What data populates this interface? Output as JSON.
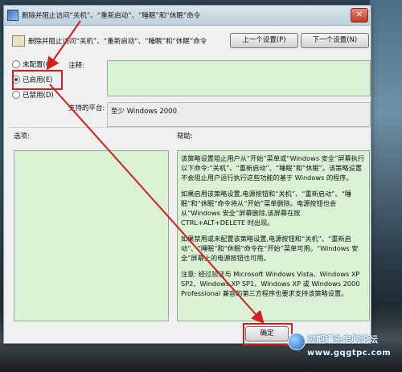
{
  "window": {
    "title": "删除并阻止访问“关机”、“重新启动”、“睡眠”和“休眠”命令",
    "close_symbol": "✕"
  },
  "header": {
    "policy_title": "删除并阻止访问“关机”、“重新启动”、“睡眠”和“休眠”命令",
    "prev_button": "上一个设置(P)",
    "next_button": "下一个设置(N)"
  },
  "state": {
    "options": [
      {
        "label": "未配置(C)",
        "checked": false
      },
      {
        "label": "已启用(E)",
        "checked": true
      },
      {
        "label": "已禁用(D)",
        "checked": false
      }
    ]
  },
  "labels": {
    "comment": "注释:",
    "supported_on": "支持的平台:",
    "options": "选项:",
    "help": "帮助:"
  },
  "supported_platform": "至少 Windows 2000",
  "help_paragraphs": [
    "该策略设置阻止用户从“开始”菜单或“Windows 安全”屏幕执行以下命令:“关机”、“重新启动”、“睡眠”和“休眠”。该策略设置不会阻止用户运行执行这些功能的基于 Windows 的程序。",
    "如果启用该策略设置,电源按钮和“关机”、“重新启动”、“睡眠”和“休眠”命令将从“开始”菜单删除。电源按钮也会从“Windows 安全”屏幕删除,该屏幕在按 CTRL+ALT+DELETE 时出现。",
    "如果禁用或未配置该策略设置,电源按钮和“关机”、“重新启动”、“睡眠”和“休眠”命令在“开始”菜单可用。“Windows 安全”屏幕上的电源按钮也可用。",
    "注意: 经过验证与 Microsoft Windows Vista、Windows XP SP2、Windows XP SP1、Windows XP 或 Windows 2000 Professional 兼容的第三方程序也要求支持该策略设置。"
  ],
  "buttons": {
    "ok": "确定"
  },
  "watermark": {
    "name": "过期罐头电脑论坛",
    "url": "www.gqgtpc.com"
  },
  "colors": {
    "highlight": "#d41e1e",
    "field_bg": "#d9f2d4"
  }
}
